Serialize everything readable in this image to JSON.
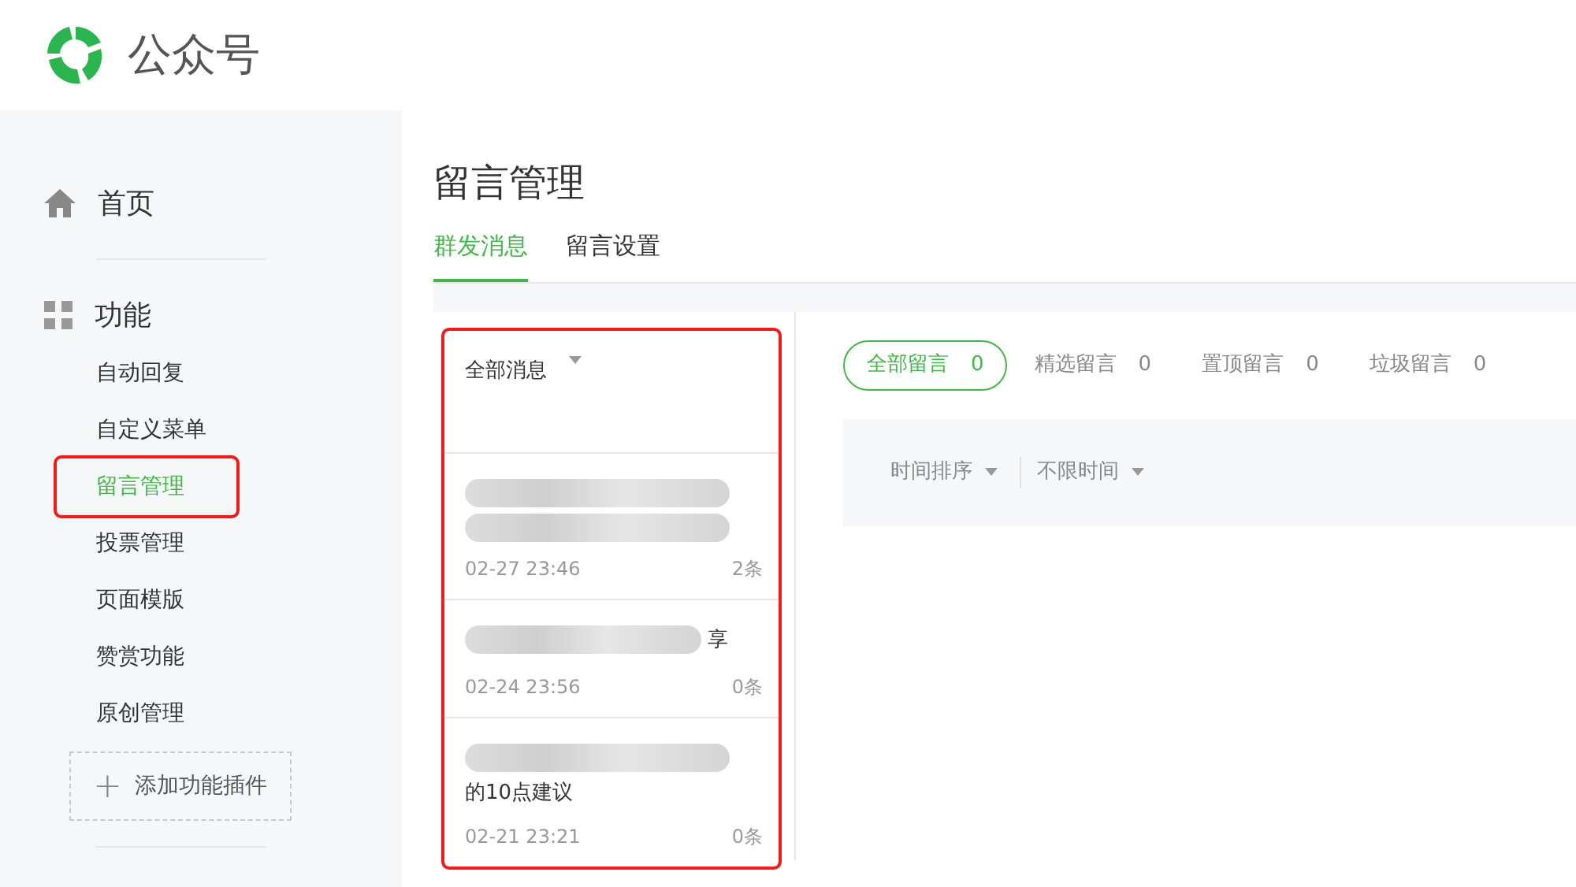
{
  "header": {
    "title": "公众号"
  },
  "sidebar": {
    "sections": [
      {
        "kind": "home",
        "label": "首页"
      },
      {
        "kind": "grid",
        "label": "功能",
        "items": [
          {
            "label": "自动回复",
            "selected": false,
            "annotated": false
          },
          {
            "label": "自定义菜单",
            "selected": false,
            "annotated": false
          },
          {
            "label": "留言管理",
            "selected": true,
            "annotated": true
          },
          {
            "label": "投票管理",
            "selected": false,
            "annotated": false
          },
          {
            "label": "页面模版",
            "selected": false,
            "annotated": false
          },
          {
            "label": "赞赏功能",
            "selected": false,
            "annotated": false
          },
          {
            "label": "原创管理",
            "selected": false,
            "annotated": false
          }
        ]
      }
    ],
    "add_button": {
      "icon": "+",
      "label": "添加功能插件"
    }
  },
  "page": {
    "title": "留言管理",
    "tabs": [
      {
        "label": "群发消息",
        "selected": true
      },
      {
        "label": "留言设置",
        "selected": false
      }
    ]
  },
  "message_list": {
    "annotated": true,
    "filter": "全部消息",
    "items": [
      {
        "time": "02-27 23:46",
        "count": "2条"
      },
      {
        "title_tail": "享",
        "time": "02-24 23:56",
        "count": "0条"
      },
      {
        "title_tail": "的10点建议",
        "time": "02-21 23:21",
        "count": "0条"
      }
    ]
  },
  "comment_filters": [
    {
      "label": "全部留言",
      "count": "0",
      "selected": true
    },
    {
      "label": "精选留言",
      "count": "0",
      "selected": false
    },
    {
      "label": "置顶留言",
      "count": "0",
      "selected": false
    },
    {
      "label": "垃圾留言",
      "count": "0",
      "selected": false
    }
  ],
  "sort_bar": [
    "时间排序",
    "不限时间"
  ]
}
